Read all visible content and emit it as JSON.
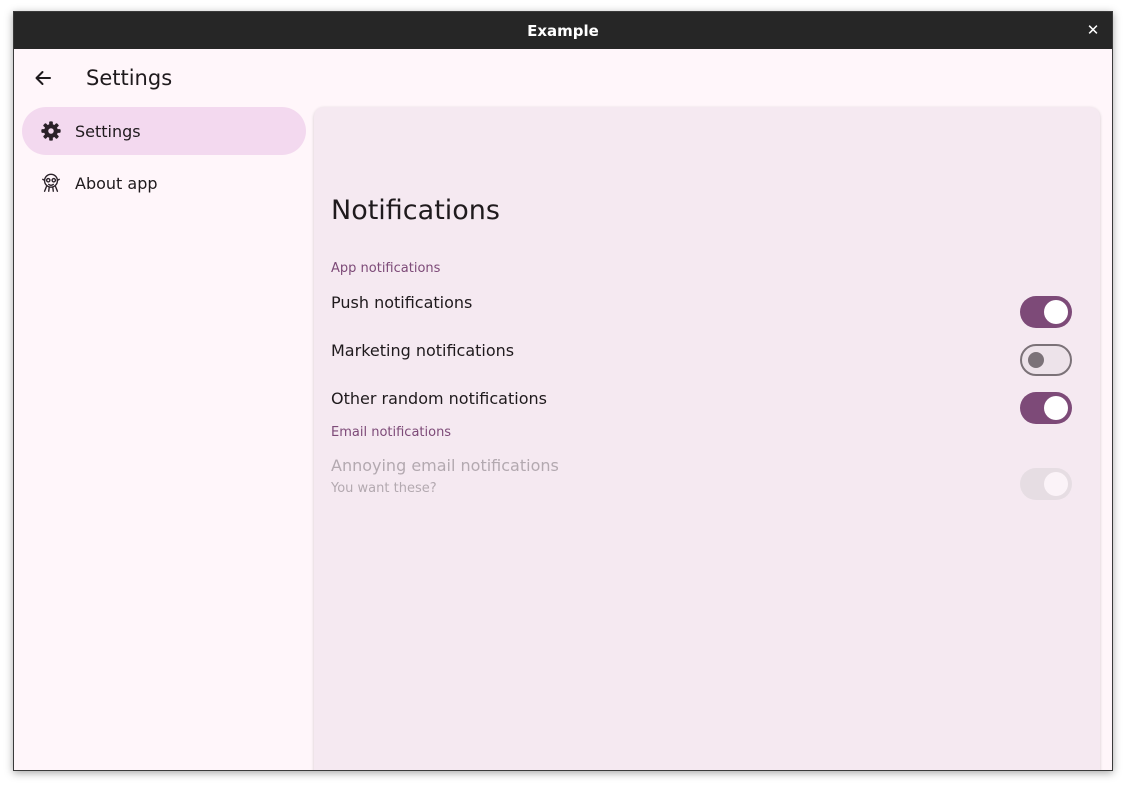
{
  "window": {
    "title": "Example",
    "close_glyph": "✕"
  },
  "header": {
    "title": "Settings",
    "back_icon": "arrow-left-icon"
  },
  "sidebar": {
    "items": [
      {
        "label": "Settings",
        "icon": "gear-icon",
        "active": true
      },
      {
        "label": "About app",
        "icon": "app-info-icon",
        "active": false
      }
    ]
  },
  "main": {
    "section_title": "Notifications",
    "groups": [
      {
        "label": "App notifications",
        "rows": [
          {
            "label": "Push notifications",
            "state": "on"
          },
          {
            "label": "Marketing notifications",
            "state": "off"
          },
          {
            "label": "Other random notifications",
            "state": "on"
          }
        ]
      },
      {
        "label": "Email notifications",
        "rows": [
          {
            "label": "Annoying email notifications",
            "sublabel": "You want these?",
            "state": "on",
            "disabled": true
          }
        ]
      }
    ]
  },
  "colors": {
    "accent": "#7d4a78",
    "nav_active": "#f3d9ef",
    "content_bg": "#f5e9f1",
    "window_bg": "#fff6fa",
    "titlebar": "#262626"
  }
}
